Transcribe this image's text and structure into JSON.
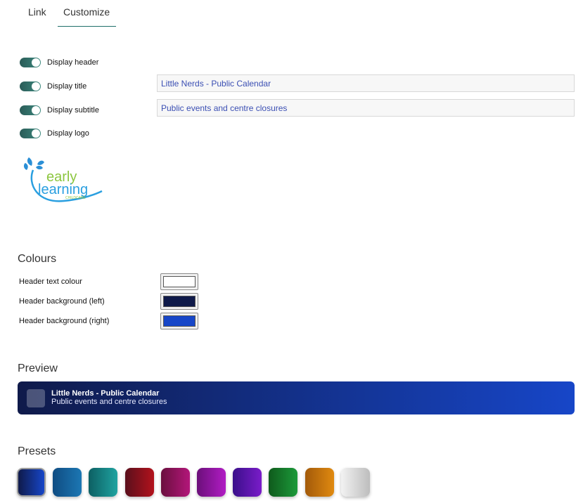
{
  "tabs": [
    {
      "label": "Link"
    },
    {
      "label": "Customize"
    }
  ],
  "toggles": [
    {
      "label": "Display header",
      "on": true
    },
    {
      "label": "Display title",
      "on": true
    },
    {
      "label": "Display subtitle",
      "on": true
    },
    {
      "label": "Display logo",
      "on": true
    }
  ],
  "fields": {
    "title_value": "Little Nerds - Public Calendar",
    "subtitle_value": "Public events and centre closures"
  },
  "logo": {
    "line1": "early",
    "line2": "learning",
    "line3": "CHILDCARE"
  },
  "colours": {
    "heading": "Colours",
    "rows": [
      {
        "label": "Header text colour",
        "value": "#ffffff"
      },
      {
        "label": "Header background (left)",
        "value": "#0f1a4a"
      },
      {
        "label": "Header background (right)",
        "value": "#1746c8"
      }
    ]
  },
  "preview": {
    "heading": "Preview",
    "title": "Little Nerds - Public Calendar",
    "subtitle": "Public events and centre closures"
  },
  "presets": {
    "heading": "Presets",
    "items": [
      {
        "from": "#0f1a4a",
        "to": "#1746c8",
        "selected": true
      },
      {
        "from": "#0f4c82",
        "to": "#1c77b3",
        "selected": false
      },
      {
        "from": "#0d5f63",
        "to": "#1fa3a0",
        "selected": false
      },
      {
        "from": "#5a0f1c",
        "to": "#b3121c",
        "selected": false
      },
      {
        "from": "#6a0f3e",
        "to": "#b3167a",
        "selected": false
      },
      {
        "from": "#6b0f7a",
        "to": "#b11cc4",
        "selected": false
      },
      {
        "from": "#3a0f8a",
        "to": "#7a1cc9",
        "selected": false
      },
      {
        "from": "#0f5a1c",
        "to": "#1c9a3a",
        "selected": false
      },
      {
        "from": "#a35a0a",
        "to": "#e08a10",
        "selected": false
      },
      {
        "from": "#f2f2f2",
        "to": "#bdbdbd",
        "selected": false
      }
    ]
  }
}
